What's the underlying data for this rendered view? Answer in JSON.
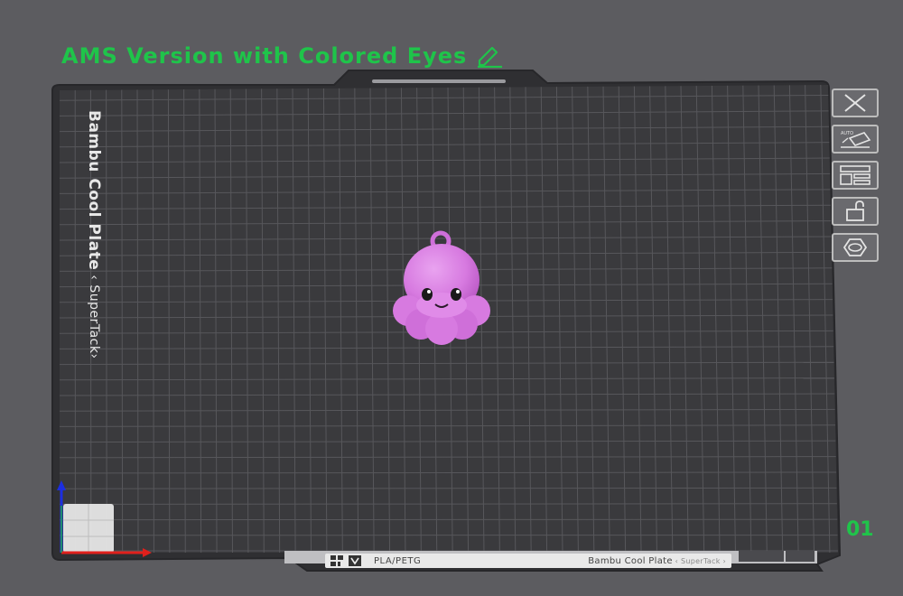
{
  "plate": {
    "title": "AMS Version with Colored Eyes",
    "number": "01",
    "side_label": "Bambu Cool Plate",
    "side_label_sub": " ‹ SuperTack›",
    "bottom_bar": {
      "filament": "PLA/PETG",
      "plate_name": "Bambu Cool Plate",
      "plate_sub": " ‹ SuperTack ›"
    }
  },
  "toolbar": {
    "items": [
      {
        "name": "close-plate-button",
        "icon": "close-icon"
      },
      {
        "name": "auto-orient-button",
        "icon": "auto-orient-icon"
      },
      {
        "name": "arrange-button",
        "icon": "arrange-icon"
      },
      {
        "name": "lock-plate-button",
        "icon": "unlock-icon"
      },
      {
        "name": "plate-settings-button",
        "icon": "hex-settings-icon"
      }
    ]
  },
  "colors": {
    "accent": "#1fc44a",
    "background": "#5c5c60",
    "plate": "#3a3a3d",
    "grid": "#58585c",
    "model": "#d77ae0",
    "axis_x": "#e0201c",
    "axis_y": "#1c2ee0"
  }
}
